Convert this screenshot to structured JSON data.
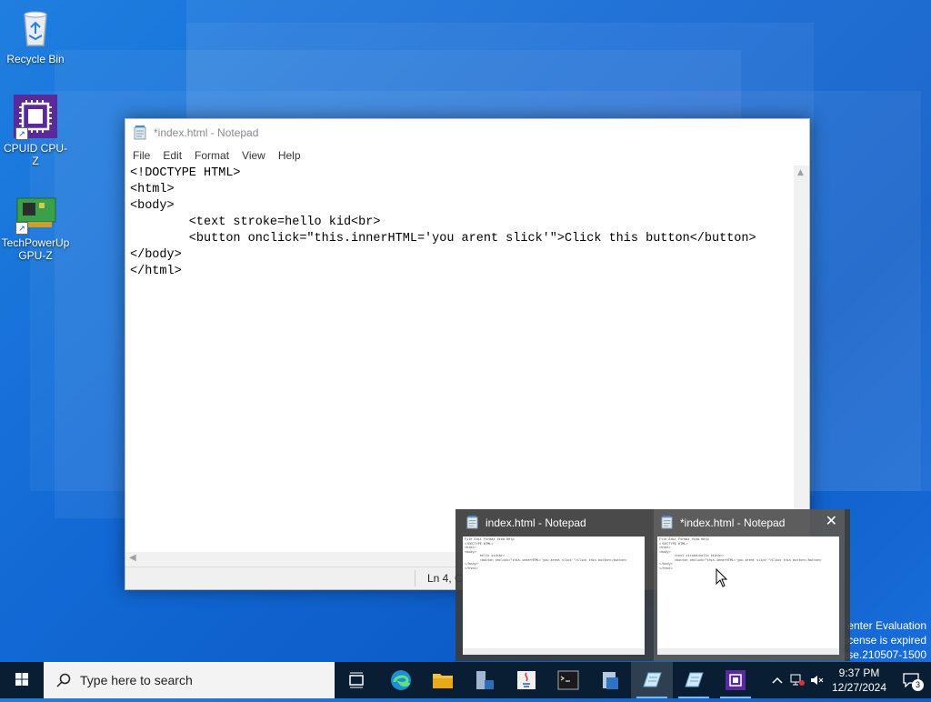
{
  "desktop": {
    "icons": [
      {
        "label": "Recycle Bin"
      },
      {
        "label": "CPUID CPU-Z"
      },
      {
        "label": "TechPowerUp GPU-Z"
      }
    ]
  },
  "notepad": {
    "title": "*index.html - Notepad",
    "menu": [
      "File",
      "Edit",
      "Format",
      "View",
      "Help"
    ],
    "lines": [
      "<!DOCTYPE HTML>",
      "<html>",
      "<body>",
      "        <text stroke=hello kid<br>",
      "        <button onclick=\"this.innerHTML='you arent slick'\">Click this button</button>",
      "</body>",
      "</html>"
    ],
    "status_position": "Ln 4, C"
  },
  "thumbnails": [
    {
      "title": "index.html - Notepad",
      "preview_lines": [
        "File Edit Format View Help",
        "<!DOCTYPE HTML>",
        "<html>",
        "<body>",
        "        hello kid<br>",
        "        <button onclick=\"this.innerHTML='you arent slick'\">Click this button</button>",
        "</body>",
        "</html>"
      ]
    },
    {
      "title": "*index.html - Notepad",
      "preview_lines": [
        "File Edit Format View Help",
        "<!DOCTYPE HTML>",
        "<html>",
        "<body>",
        "        <text stroke=hello kid<br>",
        "        <button onclick=\"this.innerHTML='you arent slick'\">Click this button</button>",
        "</body>",
        "</html>"
      ]
    }
  ],
  "watermark": {
    "line1": "enter Evaluation",
    "line2": "icense is expired",
    "line3": "ase.210507-1500"
  },
  "taskbar": {
    "search_placeholder": "Type here to search",
    "time": "9:37 PM",
    "date": "12/27/2024",
    "notification_count": "3"
  },
  "colors": {
    "desktop": "#1268d4",
    "taskbar": "#0a1e33",
    "thumb_bg": "#3c3c3c"
  }
}
